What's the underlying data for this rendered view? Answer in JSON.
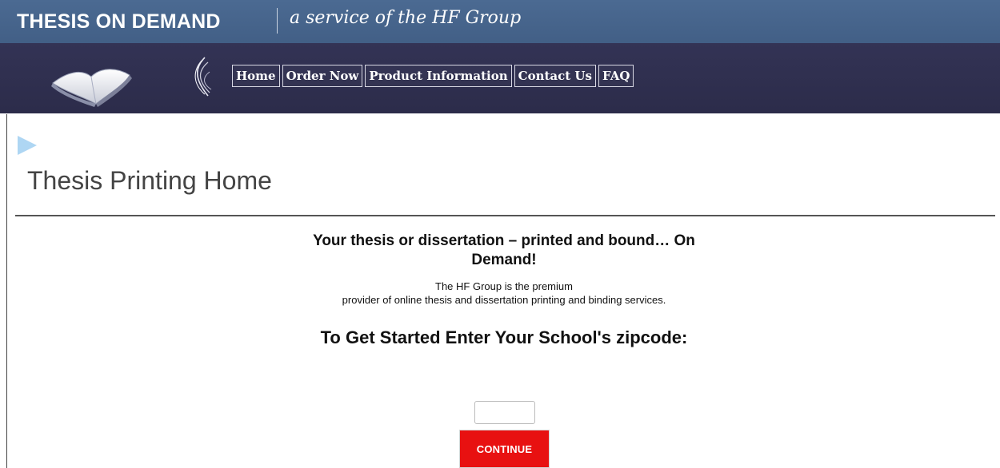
{
  "header": {
    "brand": "THESIS ON DEMAND",
    "tagline": "a service of the HF Group"
  },
  "nav": {
    "items": [
      {
        "label": "Home"
      },
      {
        "label": "Order Now"
      },
      {
        "label": "Product Information"
      },
      {
        "label": "Contact Us"
      },
      {
        "label": "FAQ"
      }
    ]
  },
  "page": {
    "title": "Thesis Printing Home"
  },
  "main": {
    "headline": "Your thesis or dissertation – printed and bound… On Demand!",
    "intro_line1": "The HF Group is the premium",
    "intro_line2": "provider of online thesis and dissertation printing and binding services.",
    "prompt": "To Get Started Enter Your School's zipcode:",
    "zip_value": "",
    "continue_label": "CONTINUE"
  },
  "colors": {
    "topbar": "#4a6890",
    "navbar": "#303050",
    "continue_button": "#e81111",
    "arrow": "#aed6f3"
  },
  "icons": {
    "logo": "open-book-icon",
    "decoration": "swirl-icon",
    "marker": "triangle-arrow-icon"
  }
}
